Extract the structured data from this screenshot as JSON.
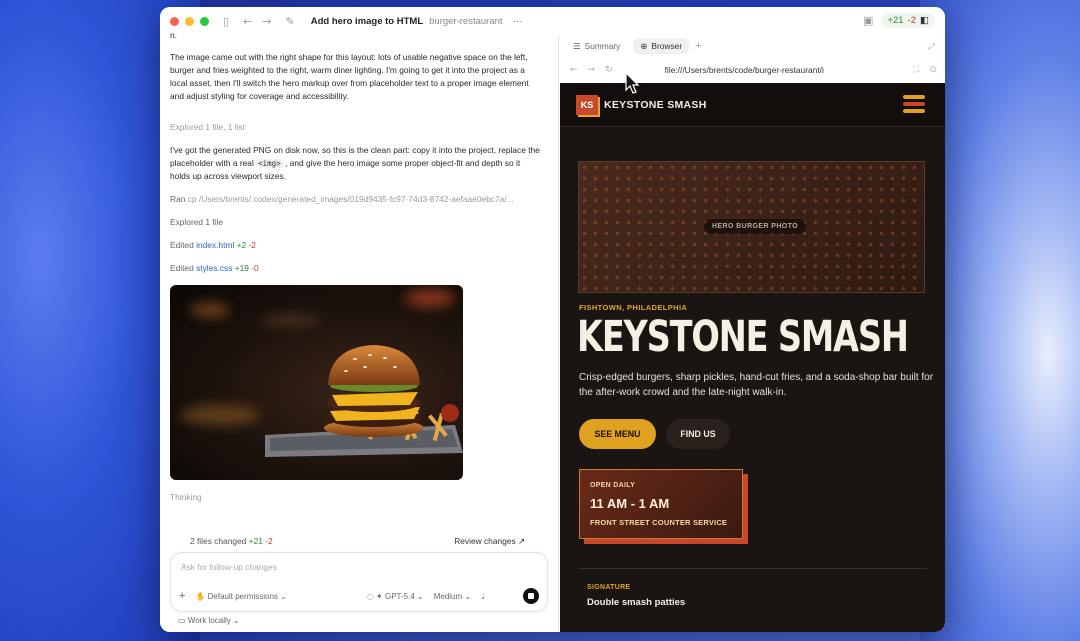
{
  "window": {
    "title": "Add hero image to HTML",
    "project": "burger-restaurant",
    "more": "···",
    "diff_plus": "+21",
    "diff_minus": "-2"
  },
  "chat": {
    "partial_line": "n.",
    "para1": "The image came out with the right shape for this layout: lots of usable negative space on the left, burger and fries weighted to the right, warm diner lighting. I'm going to get it into the project as a local asset, then I'll switch the hero markup over from placeholder text to a proper image element and adjust styling for coverage and accessibility.",
    "explored1": "Explored 1 file, 1 list",
    "para2_a": "I've got the generated PNG on disk now, so this is the clean part: copy it into the project, replace the placeholder with a real",
    "para2_code": "<img>",
    "para2_b": ", and give the hero image some proper object-fit and depth so it holds up across viewport sizes.",
    "ran_label": "Ran",
    "ran_cmd": "cp /Users/brents/.codex/generated_images/019d9435-fc97-74d3-8742-aefaae0ebc7a/...",
    "explored2": "Explored 1 file",
    "edit1_label": "Edited",
    "edit1_file": "index.html",
    "edit1_plus": "+2",
    "edit1_minus": "-2",
    "edit2_label": "Edited",
    "edit2_file": "styles.css",
    "edit2_plus": "+19",
    "edit2_minus": "-0",
    "thinking": "Thinking"
  },
  "changes_bar": {
    "label": "2 files changed",
    "plus": "+21",
    "minus": "-2",
    "review": "Review changes ↗"
  },
  "composer": {
    "placeholder": "Ask for follow-up changes",
    "add": "+",
    "permissions": "Default permissions ⌄",
    "model": "GPT-5.4 ⌄",
    "effort": "Medium ⌄",
    "mic": "🎙",
    "work_locally": "Work locally ⌄"
  },
  "browser": {
    "tab_summary": "Summary",
    "tab_browser": "Browser",
    "tab_add": "+",
    "url": "file:///Users/brents/code/burger-restaurant/i"
  },
  "site": {
    "logo_badge": "KS",
    "logo_text": "KEYSTONE SMASH",
    "hero_placeholder": "HERO BURGER PHOTO",
    "eyebrow": "FISHTOWN, PHILADELPHIA",
    "title": "KEYSTONE SMASH",
    "lede": "Crisp-edged burgers, sharp pickles, hand-cut fries, and a soda-shop bar built for the after-work crowd and the late-night walk-in.",
    "btn_menu": "SEE MENU",
    "btn_find": "FIND US",
    "hours_label": "OPEN DAILY",
    "hours_time": "11 AM - 1 AM",
    "hours_service": "FRONT STREET COUNTER SERVICE",
    "signature_label": "SIGNATURE",
    "signature_text": "Double smash patties"
  },
  "colors": {
    "accent_amber": "#e0a020",
    "accent_red": "#c8462a",
    "site_bg": "#1a1412",
    "link_blue": "#2a62c9",
    "diff_green": "#2a8a3a",
    "diff_red": "#c0392b"
  }
}
